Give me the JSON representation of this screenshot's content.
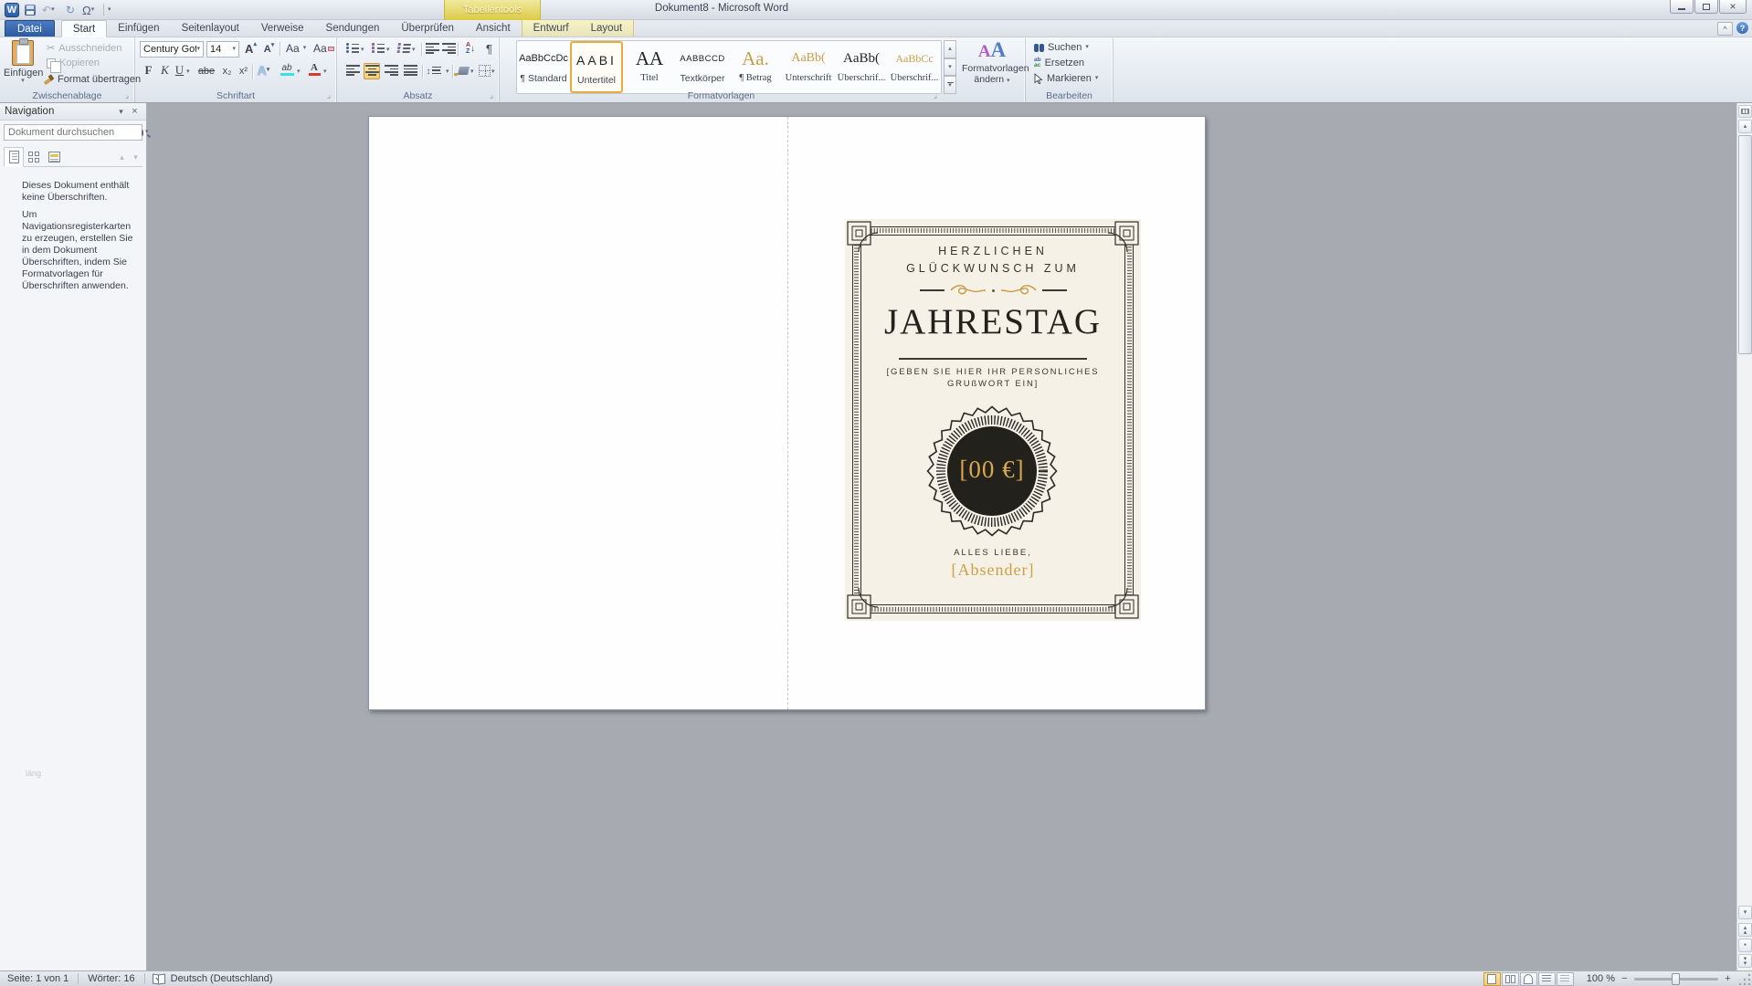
{
  "window": {
    "title": "Dokument8 - Microsoft Word",
    "contextual_tool": "Tabellentools"
  },
  "glyphs": {
    "word_logo": "W",
    "undo": "↶",
    "redo": "↻",
    "omega": "Ω",
    "dropdown": "▾",
    "up": "▴",
    "close": "×",
    "help": "?",
    "chevron_up": "^",
    "launcher": "⌟",
    "scissors": "✂",
    "bold": "F",
    "italic": "K",
    "underline": "U",
    "strikethrough": "abe",
    "subscript": "x₂",
    "superscript": "x²",
    "grow_font": "A",
    "shrink_font": "A",
    "change_case": "Aa",
    "clear_format": "Aa",
    "text_effects": "A",
    "highlight": "ab",
    "font_color": "A",
    "pilcrow": "¶",
    "sort_a": "A",
    "sort_z": "Z",
    "sort_arrow": "↓",
    "updown": "↕",
    "style_a1": "A",
    "style_a2": "A",
    "replace_top": "ab",
    "replace_bottom": "ac",
    "browse_dot": "●",
    "minus": "−",
    "plus": "+"
  },
  "tabs": {
    "file": "Datei",
    "main": [
      "Start",
      "Einfügen",
      "Seitenlayout",
      "Verweise",
      "Sendungen",
      "Überprüfen",
      "Ansicht"
    ],
    "contextual": [
      "Entwurf",
      "Layout"
    ]
  },
  "clipboard": {
    "label": "Zwischenablage",
    "paste": "Einfügen",
    "cut": "Ausschneiden",
    "copy": "Kopieren",
    "format_painter": "Format übertragen"
  },
  "font": {
    "label": "Schriftart",
    "name": "Century Goth",
    "size": "14"
  },
  "paragraph": {
    "label": "Absatz"
  },
  "styles": {
    "label": "Formatvorlagen",
    "change_line1": "Formatvorlagen",
    "change_line2": "ändern",
    "items": [
      {
        "preview": "AaBbCcDc",
        "name": "¶ Standard"
      },
      {
        "preview": "AABI",
        "name": "Untertitel"
      },
      {
        "preview": "AA",
        "name": "Titel"
      },
      {
        "preview": "AABBCCD",
        "name": "Textkörper"
      },
      {
        "preview": "Aa.",
        "name": "¶ Betrag"
      },
      {
        "preview": "AaBb(",
        "name": "Unterschrift"
      },
      {
        "preview": "AaBb(",
        "name": "Überschrif..."
      },
      {
        "preview": "AaBbCc",
        "name": "Überschrif..."
      }
    ]
  },
  "editing": {
    "label": "Bearbeiten",
    "find": "Suchen",
    "replace": "Ersetzen",
    "select": "Markieren"
  },
  "nav": {
    "title": "Navigation",
    "search_placeholder": "Dokument durchsuchen",
    "empty": "Dieses Dokument enthält keine Überschriften.",
    "hint": "Um Navigationsregisterkarten zu erzeugen, erstellen Sie in dem Dokument Überschriften, indem Sie Formatvorlagen für Überschriften anwenden.",
    "stray": "läng"
  },
  "card": {
    "greeting1": "HERZLICHEN",
    "greeting2": "GLÜCKWUNSCH ZUM",
    "title": "JAHRESTAG",
    "placeholder1": "[GEBEN SIE HIER IHR PERSONLICHES",
    "placeholder2": "GRUßWORT EIN]",
    "amount": "[00 €]",
    "closing": "ALLES LIEBE,",
    "sender": "[Absender]"
  },
  "status": {
    "page": "Seite: 1 von 1",
    "words": "Wörter: 16",
    "language": "Deutsch (Deutschland)",
    "zoom": "100 %"
  },
  "colors": {
    "gold": "#cf9f45",
    "card_bg": "#f5f1e6",
    "ink": "#2e2d28",
    "badge_bg": "#22211c",
    "file_blue": "#3a6cb5",
    "context_yellow": "#e7d95e",
    "select_orange": "#f0a73c"
  }
}
